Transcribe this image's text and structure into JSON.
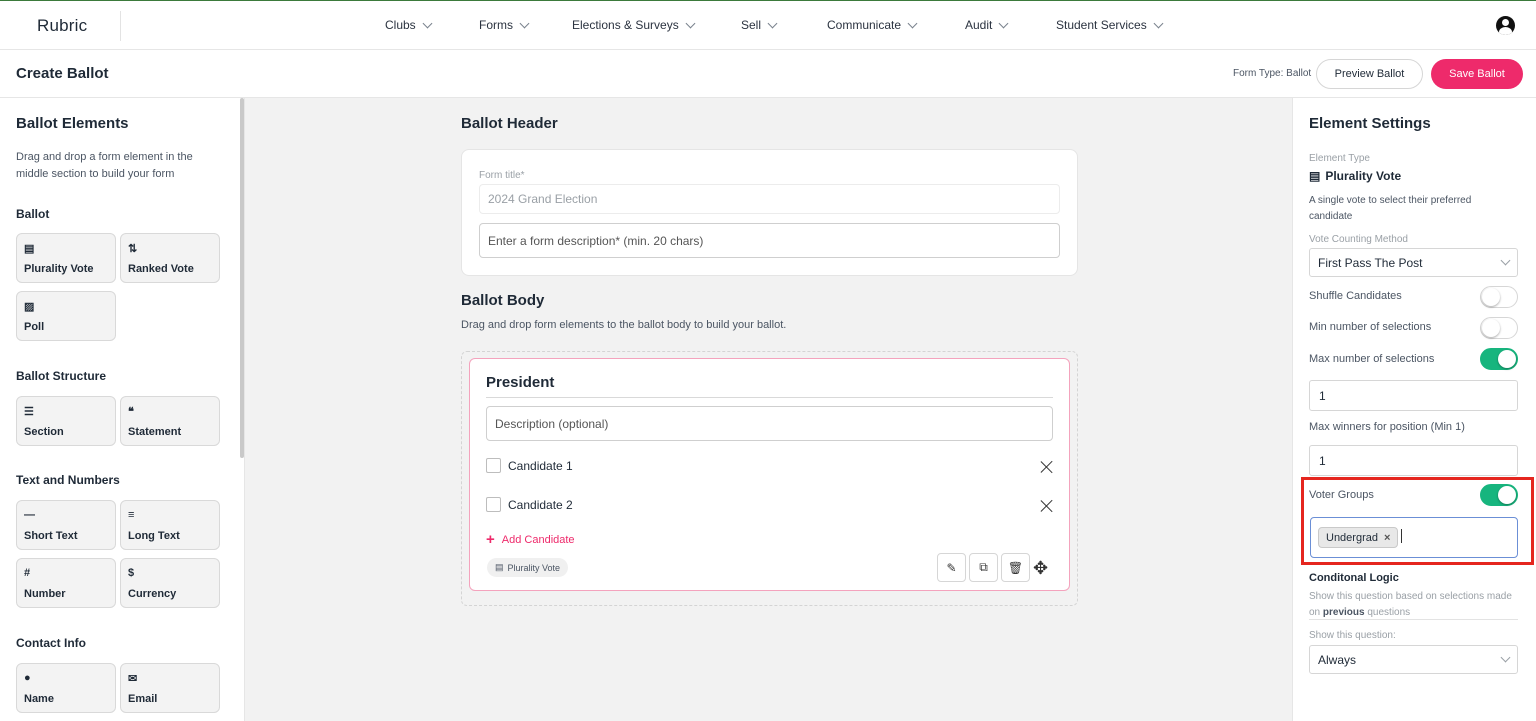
{
  "app": {
    "logo": "Rubric"
  },
  "nav": {
    "items": [
      "Clubs",
      "Forms",
      "Elections & Surveys",
      "Sell",
      "Communicate",
      "Audit",
      "Student Services"
    ]
  },
  "header": {
    "title": "Create Ballot",
    "form_type": "Form Type: Ballot",
    "preview_label": "Preview Ballot",
    "save_label": "Save Ballot"
  },
  "sidebar": {
    "title": "Ballot Elements",
    "description": "Drag and drop a form element in the middle section to build your form",
    "sections": [
      {
        "title": "Ballot",
        "items": [
          {
            "icon": "ballot-box-icon",
            "label": "Plurality Vote"
          },
          {
            "icon": "sort-arrows-icon",
            "label": "Ranked Vote"
          },
          {
            "icon": "poll-icon",
            "label": "Poll"
          }
        ]
      },
      {
        "title": "Ballot Structure",
        "items": [
          {
            "icon": "section-icon",
            "label": "Section"
          },
          {
            "icon": "quote-icon",
            "label": "Statement"
          }
        ]
      },
      {
        "title": "Text and Numbers",
        "items": [
          {
            "icon": "dash-icon",
            "label": "Short Text"
          },
          {
            "icon": "lines-icon",
            "label": "Long Text"
          },
          {
            "icon": "hash-icon",
            "label": "Number"
          },
          {
            "icon": "dollar-icon",
            "label": "Currency"
          }
        ]
      },
      {
        "title": "Contact Info",
        "items": [
          {
            "icon": "person-icon",
            "label": "Name"
          },
          {
            "icon": "envelope-icon",
            "label": "Email"
          }
        ]
      }
    ]
  },
  "ballot_header": {
    "title": "Ballot Header",
    "form_title_label": "Form title*",
    "form_title_value": "2024 Grand Election",
    "description_placeholder": "Enter a form description* (min. 20 chars)"
  },
  "ballot_body": {
    "title": "Ballot Body",
    "description": "Drag and drop form elements to the ballot body to build your ballot.",
    "question": {
      "title": "President",
      "description_placeholder": "Description (optional)",
      "candidates": [
        "Candidate 1",
        "Candidate 2"
      ],
      "add_candidate_label": "Add Candidate",
      "type_chip": "Plurality Vote"
    }
  },
  "settings": {
    "title": "Element Settings",
    "element_type_label": "Element Type",
    "element_type_value": "Plurality Vote",
    "element_type_desc": "A single vote to select their preferred candidate",
    "counting_method_label": "Vote Counting Method",
    "counting_method_value": "First Pass The Post",
    "shuffle_label": "Shuffle Candidates",
    "shuffle_on": false,
    "min_label": "Min number of selections",
    "min_on": false,
    "max_label": "Max number of selections",
    "max_on": true,
    "max_value": "1",
    "max_winners_label": "Max winners for position (Min 1)",
    "max_winners_value": "1",
    "voter_groups_label": "Voter Groups",
    "voter_groups_on": true,
    "voter_group_tags": [
      "Undergrad"
    ],
    "conditional_title": "Conditonal Logic",
    "conditional_desc_1": "Show this question based on selections made",
    "conditional_desc_on": "on",
    "conditional_desc_previous": "previous",
    "conditional_desc_questions": "questions",
    "show_label": "Show this question:",
    "show_value": "Always"
  },
  "colors": {
    "accent": "#ee2a6b",
    "toggle_on": "#17b57e",
    "highlight": "#e5261f"
  }
}
